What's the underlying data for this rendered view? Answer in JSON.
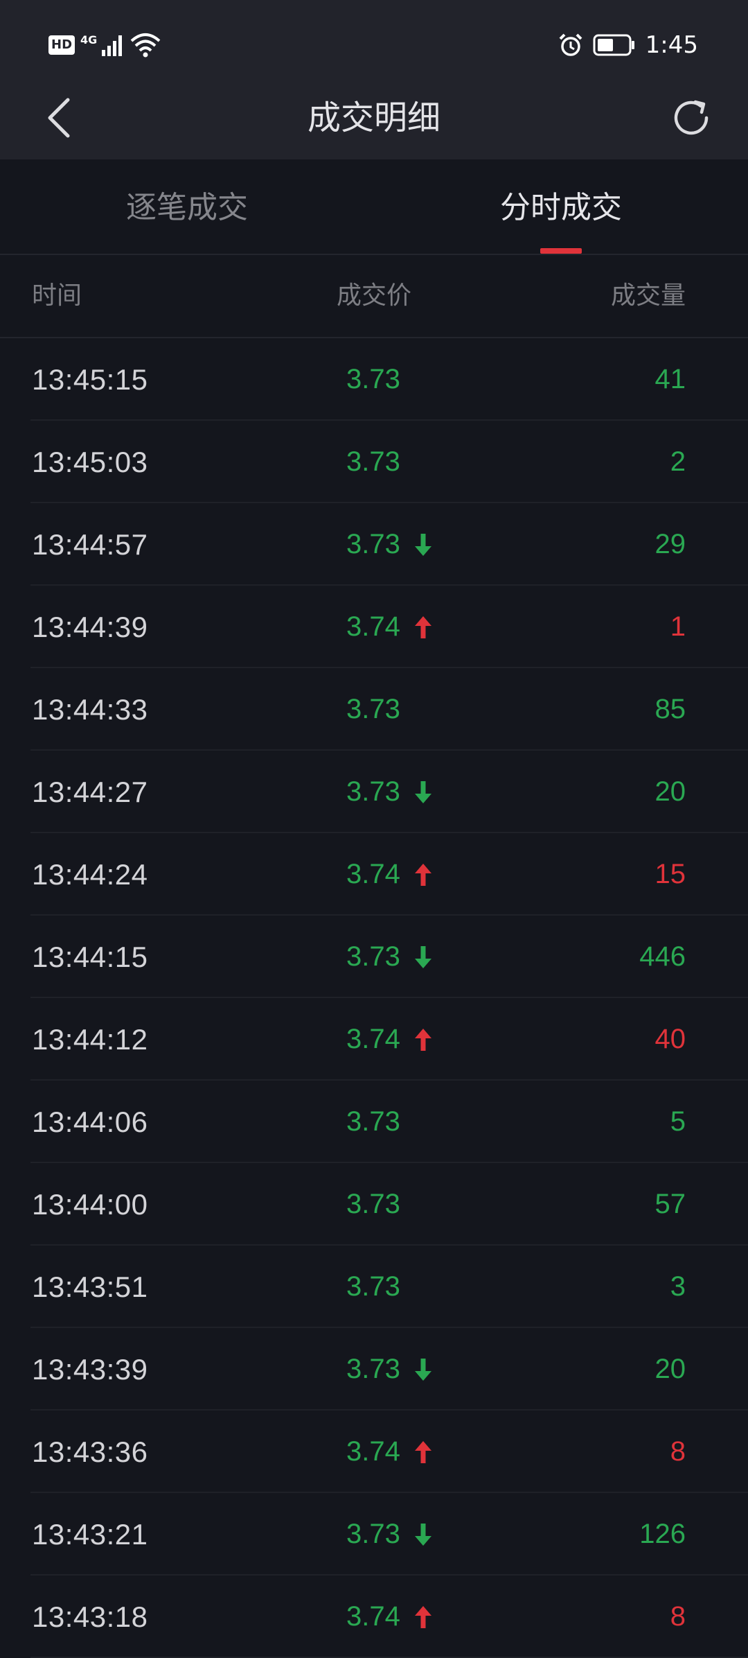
{
  "status_bar": {
    "hd_badge": "HD",
    "network": "4G",
    "time": "1:45"
  },
  "nav": {
    "title": "成交明细"
  },
  "tabs": [
    {
      "label": "逐笔成交",
      "active": false
    },
    {
      "label": "分时成交",
      "active": true
    }
  ],
  "table": {
    "headers": {
      "time": "时间",
      "price": "成交价",
      "volume": "成交量"
    },
    "rows": [
      {
        "time": "13:45:15",
        "price": "3.73",
        "arrow": "none",
        "volume": "41",
        "volume_color": "green"
      },
      {
        "time": "13:45:03",
        "price": "3.73",
        "arrow": "none",
        "volume": "2",
        "volume_color": "green"
      },
      {
        "time": "13:44:57",
        "price": "3.73",
        "arrow": "down",
        "volume": "29",
        "volume_color": "green"
      },
      {
        "time": "13:44:39",
        "price": "3.74",
        "arrow": "up",
        "volume": "1",
        "volume_color": "red"
      },
      {
        "time": "13:44:33",
        "price": "3.73",
        "arrow": "none",
        "volume": "85",
        "volume_color": "green"
      },
      {
        "time": "13:44:27",
        "price": "3.73",
        "arrow": "down",
        "volume": "20",
        "volume_color": "green"
      },
      {
        "time": "13:44:24",
        "price": "3.74",
        "arrow": "up",
        "volume": "15",
        "volume_color": "red"
      },
      {
        "time": "13:44:15",
        "price": "3.73",
        "arrow": "down",
        "volume": "446",
        "volume_color": "green"
      },
      {
        "time": "13:44:12",
        "price": "3.74",
        "arrow": "up",
        "volume": "40",
        "volume_color": "red"
      },
      {
        "time": "13:44:06",
        "price": "3.73",
        "arrow": "none",
        "volume": "5",
        "volume_color": "green"
      },
      {
        "time": "13:44:00",
        "price": "3.73",
        "arrow": "none",
        "volume": "57",
        "volume_color": "green"
      },
      {
        "time": "13:43:51",
        "price": "3.73",
        "arrow": "none",
        "volume": "3",
        "volume_color": "green"
      },
      {
        "time": "13:43:39",
        "price": "3.73",
        "arrow": "down",
        "volume": "20",
        "volume_color": "green"
      },
      {
        "time": "13:43:36",
        "price": "3.74",
        "arrow": "up",
        "volume": "8",
        "volume_color": "red"
      },
      {
        "time": "13:43:21",
        "price": "3.73",
        "arrow": "down",
        "volume": "126",
        "volume_color": "green"
      },
      {
        "time": "13:43:18",
        "price": "3.74",
        "arrow": "up",
        "volume": "8",
        "volume_color": "red"
      }
    ]
  },
  "colors": {
    "up": "#e0333a",
    "down": "#2aa852",
    "background": "#14161d",
    "header_bg": "#22232b"
  },
  "icons": {
    "back": "chevron-left-icon",
    "refresh": "refresh-icon",
    "signal": "signal-icon",
    "wifi": "wifi-icon",
    "alarm": "alarm-icon",
    "battery": "battery-icon"
  }
}
